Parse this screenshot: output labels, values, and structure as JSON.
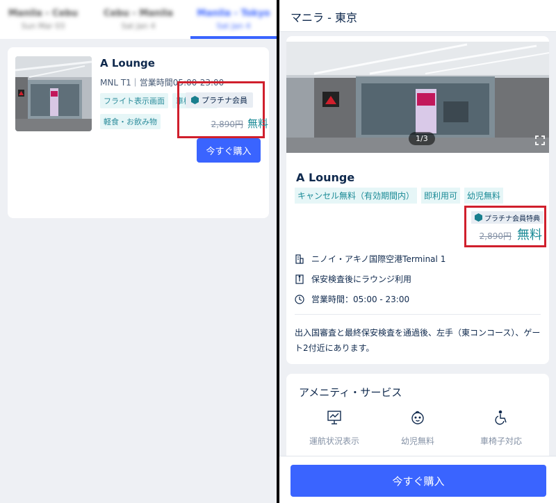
{
  "left": {
    "tabs": [
      {
        "label": "Manila - Cebu",
        "date": "Sun Mar 03"
      },
      {
        "label": "Cebu - Manila",
        "date": "Sat Jan 4"
      },
      {
        "label": "Manila - Tokyo",
        "date": "Sat Jan 4"
      }
    ],
    "card": {
      "title": "A Lounge",
      "subtitle": "MNL T1｜営業時間05:00-23:00",
      "chips": [
        "フライト表示画面",
        "車椅子対応",
        "軽食・お飲み物"
      ],
      "badge": "プラチナ会員",
      "original_price": "2,890円",
      "price": "無料",
      "buy_label": "今すぐ購入"
    }
  },
  "right": {
    "header_title": "マニラ - 東京",
    "gallery_counter": "1/3",
    "name": "A Lounge",
    "chips": [
      "キャンセル無料（有効期間内）",
      "即利用可",
      "幼児無料"
    ],
    "badge": "プラチナ会員特典",
    "original_price": "2,890円",
    "price": "無料",
    "info": {
      "location": "ニノイ・アキノ国際空港Terminal 1",
      "security": "保安検査後にラウンジ利用",
      "hours": "営業時間：05:00 - 23:00"
    },
    "description": "出入国審査と最終保安検査を通過後、左手（東コンコース）、ゲート2付近にあります。",
    "amenities_title": "アメニティ・サービス",
    "amenities": [
      "運航状況表示",
      "幼児無料",
      "車椅子対応"
    ],
    "buy_label": "今すぐ購入"
  },
  "colors": {
    "accent": "#3a64ff",
    "teal": "#1a8a96",
    "highlight_red": "#d01f2c"
  }
}
